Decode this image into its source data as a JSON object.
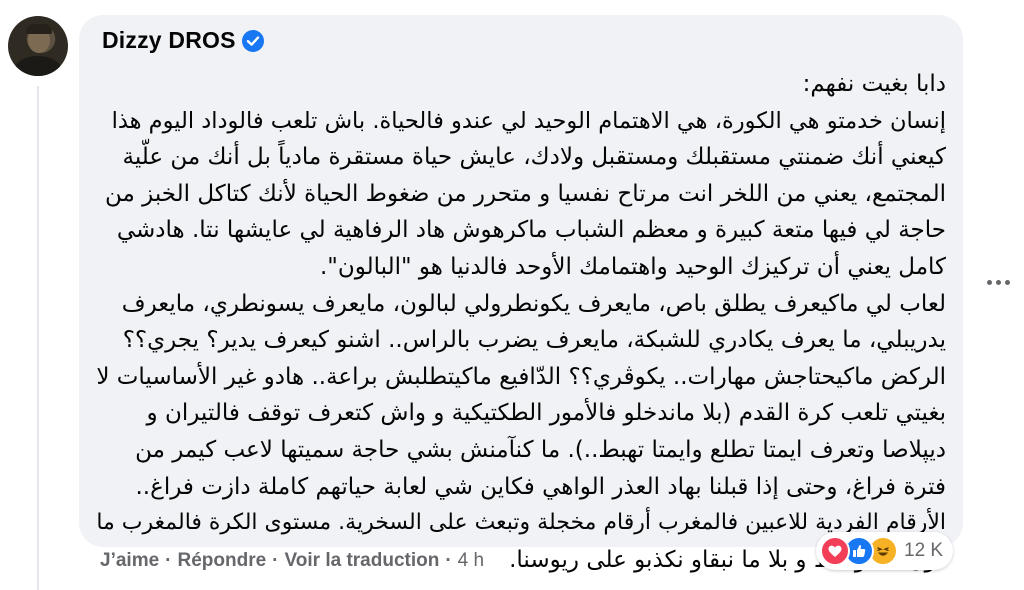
{
  "comment": {
    "author": "Dizzy DROS",
    "verified": true,
    "text_lines": [
      "دابا بغيت نفهم:",
      "إنسان خدمتو هي الكورة، هي الاهتمام الوحيد لي عندو فالحياة. باش تلعب فالوداد اليوم هذا",
      "كيعني أنك ضمنتي مستقبلك ومستقبل ولادك، عايش حياة مستقرة مادياً بل أنك من علّية",
      "المجتمع، يعني من اللخر انت مرتاح نفسيا و متحرر من ضغوط الحياة لأنك كتاكل الخبز من",
      "حاجة لي فيها متعة كبيرة و معظم الشباب ماكرهوش هاد الرفاهية لي عايشها نتا. هادشي",
      "كامل يعني أن تركيزك الوحيد واهتمامك الأوحد فالدنيا هو \"البالون\".",
      "لعاب لي ماكيعرف يطلق باص، مايعرف يكونطرولي لبالون، مايعرف يسونطري، مايعرف",
      "يدريبلي، ما يعرف يكادري للشبكة، مايعرف يضرب بالراس.. اشنو كيعرف يدير؟ يجري؟؟",
      "الركض ماكيحتاجش مهارات.. يكوڤري؟؟ الدّافيع ماكيتطلبش براعة.. هادو غير الأساسيات لا",
      "بغيتي تلعب كرة القدم (بلا ماندخلو فالأمور الطكتيكية و واش كتعرف توقف فالتيران و",
      "ديپلاصا وتعرف ايمتا تطلع وايمتا تهبط..). ما كنآمنش بشي حاجة سميتها لاعب كيمر من",
      "فترة فراغ، وحتى إذا قبلنا بهاد العذر الواهي فكاين شي لعابة حياتهم كاملة دازت فراغ..",
      "الأرقام الفردية للاعبين فالمغرب أرقام مخجلة وتبعث على السخرية. مستوى الكرة فالمغرب ما",
      "دون المتوسط و بلا ما نبقاو نكذبو على ريوسنا."
    ]
  },
  "actions": {
    "like": "J’aime",
    "reply": "Répondre",
    "translate": "Voir la traduction",
    "separator": "·",
    "time": "4 h"
  },
  "reactions": {
    "icons": [
      "love-icon",
      "like-icon",
      "haha-icon"
    ],
    "count": "12 K"
  },
  "colors": {
    "bubble": "#f0f2f5",
    "text": "#050505",
    "secondary": "#65676b",
    "verified": "#1877f2",
    "love": "#f33e58",
    "haha": "#f7b125"
  }
}
